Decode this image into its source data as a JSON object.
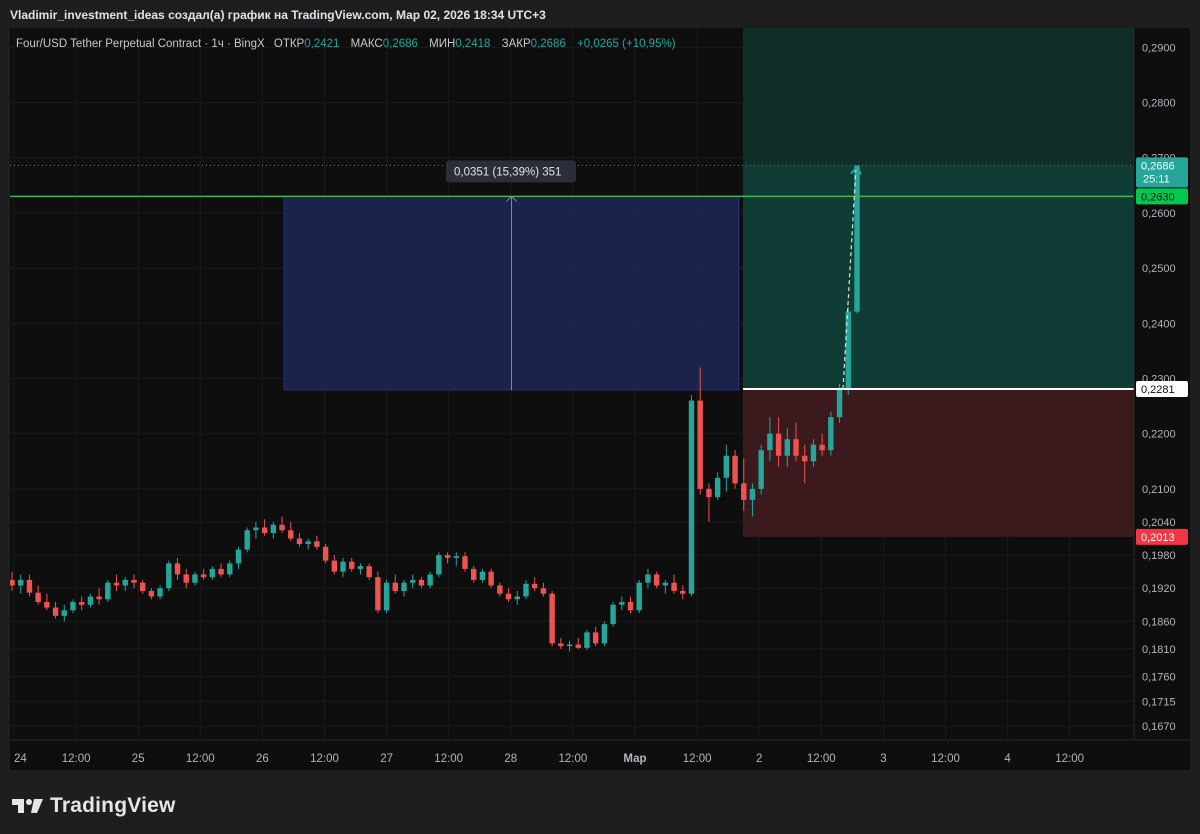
{
  "header": {
    "title": "Vladimir_investment_ideas создал(а) график на TradingView.com, Мар 02, 2026 18:34 UTC+3"
  },
  "legend": {
    "symbol": "Four/USD Tether Perpetual Contract · 1ч · BingX",
    "open_label": "ОТКР",
    "open": "0,2421",
    "high_label": "МАКС",
    "high": "0,2686",
    "low_label": "МИН",
    "low": "0,2418",
    "close_label": "ЗАКР",
    "close": "0,2686",
    "change": "+0,0265 (+10,95%)"
  },
  "measure_label": "0,0351 (15,39%) 351",
  "price_tags": {
    "last_price": "0,2686",
    "countdown": "25:11",
    "target": "0,2630",
    "entry": "0,2281",
    "stop": "0,2013"
  },
  "colors": {
    "up": "#26a69a",
    "down": "#ef5350",
    "background": "#0e0e0e",
    "green_line": "#4caf50",
    "measure_fill": "#1a2550",
    "profit_fill": "#0f3d36",
    "loss_fill": "#3a1a1c",
    "entry_line": "#ffffff"
  },
  "footer": {
    "brand": "TradingView",
    "logo_icon": "tradingview-logo-icon"
  },
  "chart_data": {
    "type": "candlestick",
    "timeframe": "1h",
    "symbol": "FOUR/USDT Perp",
    "price_scale": [
      "0,2900",
      "0,2800",
      "0,2700",
      "0,2600",
      "0,2500",
      "0,2400",
      "0,2300",
      "0,2200",
      "0,2100",
      "0,2040",
      "0,1980",
      "0,1920",
      "0,1860",
      "0,1810",
      "0,1760",
      "0,1715",
      "0,1670"
    ],
    "time_labels": [
      "24",
      "12:00",
      "25",
      "12:00",
      "26",
      "12:00",
      "27",
      "12:00",
      "28",
      "12:00",
      "Мар",
      "12:00",
      "2",
      "12:00",
      "3",
      "12:00",
      "4",
      "12:00"
    ],
    "price_range": [
      0.1645,
      0.2935
    ],
    "target_line": 0.263,
    "entry": 0.2281,
    "stop": 0.2013,
    "take_profit_zone_top": 0.2935,
    "last_price": 0.2686,
    "measure": {
      "from": 0.2279,
      "to": 0.263,
      "delta": "0,0351",
      "percent": "15,39%",
      "bars": 351
    },
    "candles": [
      [
        0.1935,
        0.195,
        0.1915,
        0.1925
      ],
      [
        0.1925,
        0.1945,
        0.191,
        0.1935
      ],
      [
        0.1935,
        0.1945,
        0.1905,
        0.1912
      ],
      [
        0.1912,
        0.1925,
        0.189,
        0.1895
      ],
      [
        0.1895,
        0.191,
        0.188,
        0.1885
      ],
      [
        0.1885,
        0.1895,
        0.1865,
        0.187
      ],
      [
        0.187,
        0.189,
        0.186,
        0.188
      ],
      [
        0.188,
        0.19,
        0.1875,
        0.1895
      ],
      [
        0.1895,
        0.1905,
        0.188,
        0.189
      ],
      [
        0.189,
        0.191,
        0.1885,
        0.1905
      ],
      [
        0.1905,
        0.192,
        0.189,
        0.19
      ],
      [
        0.19,
        0.1935,
        0.1895,
        0.193
      ],
      [
        0.193,
        0.1945,
        0.1915,
        0.1925
      ],
      [
        0.1925,
        0.194,
        0.1915,
        0.1935
      ],
      [
        0.1935,
        0.1945,
        0.192,
        0.193
      ],
      [
        0.193,
        0.1935,
        0.191,
        0.1915
      ],
      [
        0.1915,
        0.192,
        0.19,
        0.1905
      ],
      [
        0.1905,
        0.1925,
        0.19,
        0.192
      ],
      [
        0.192,
        0.197,
        0.1915,
        0.1965
      ],
      [
        0.1965,
        0.1975,
        0.1935,
        0.1945
      ],
      [
        0.1945,
        0.1955,
        0.192,
        0.193
      ],
      [
        0.193,
        0.195,
        0.1925,
        0.1945
      ],
      [
        0.1945,
        0.1955,
        0.1935,
        0.194
      ],
      [
        0.194,
        0.196,
        0.1935,
        0.1955
      ],
      [
        0.1955,
        0.1965,
        0.194,
        0.1945
      ],
      [
        0.1945,
        0.197,
        0.194,
        0.1965
      ],
      [
        0.1965,
        0.1995,
        0.1955,
        0.199
      ],
      [
        0.199,
        0.203,
        0.1985,
        0.2025
      ],
      [
        0.2025,
        0.204,
        0.201,
        0.203
      ],
      [
        0.203,
        0.2045,
        0.2015,
        0.202
      ],
      [
        0.202,
        0.204,
        0.201,
        0.2035
      ],
      [
        0.2035,
        0.205,
        0.202,
        0.2025
      ],
      [
        0.2025,
        0.204,
        0.2005,
        0.201
      ],
      [
        0.201,
        0.202,
        0.1995,
        0.2
      ],
      [
        0.2,
        0.201,
        0.199,
        0.2005
      ],
      [
        0.2005,
        0.2015,
        0.199,
        0.1995
      ],
      [
        0.1995,
        0.2,
        0.1965,
        0.197
      ],
      [
        0.197,
        0.198,
        0.1945,
        0.195
      ],
      [
        0.195,
        0.1975,
        0.194,
        0.1968
      ],
      [
        0.1968,
        0.1975,
        0.195,
        0.1955
      ],
      [
        0.1955,
        0.1965,
        0.1945,
        0.196
      ],
      [
        0.196,
        0.1965,
        0.1935,
        0.194
      ],
      [
        0.194,
        0.195,
        0.1875,
        0.188
      ],
      [
        0.188,
        0.1935,
        0.1875,
        0.193
      ],
      [
        0.193,
        0.1945,
        0.191,
        0.1915
      ],
      [
        0.1915,
        0.1935,
        0.1905,
        0.193
      ],
      [
        0.193,
        0.1945,
        0.192,
        0.1935
      ],
      [
        0.1935,
        0.194,
        0.192,
        0.1925
      ],
      [
        0.1925,
        0.195,
        0.192,
        0.1945
      ],
      [
        0.1945,
        0.1985,
        0.194,
        0.198
      ],
      [
        0.198,
        0.1985,
        0.1965,
        0.1975
      ],
      [
        0.1975,
        0.1985,
        0.196,
        0.1978
      ],
      [
        0.1978,
        0.1985,
        0.195,
        0.1955
      ],
      [
        0.1955,
        0.196,
        0.193,
        0.1935
      ],
      [
        0.1935,
        0.1955,
        0.193,
        0.195
      ],
      [
        0.195,
        0.1955,
        0.192,
        0.1925
      ],
      [
        0.1925,
        0.193,
        0.1905,
        0.191
      ],
      [
        0.191,
        0.192,
        0.1895,
        0.19
      ],
      [
        0.19,
        0.1915,
        0.189,
        0.1905
      ],
      [
        0.1905,
        0.1935,
        0.19,
        0.1928
      ],
      [
        0.1928,
        0.194,
        0.1915,
        0.192
      ],
      [
        0.192,
        0.193,
        0.1905,
        0.191
      ],
      [
        0.191,
        0.1915,
        0.1815,
        0.182
      ],
      [
        0.182,
        0.183,
        0.181,
        0.1815
      ],
      [
        0.1815,
        0.1825,
        0.1805,
        0.1818
      ],
      [
        0.1818,
        0.183,
        0.181,
        0.1812
      ],
      [
        0.1812,
        0.1845,
        0.1808,
        0.184
      ],
      [
        0.184,
        0.185,
        0.1815,
        0.182
      ],
      [
        0.182,
        0.186,
        0.1815,
        0.1855
      ],
      [
        0.1855,
        0.1895,
        0.185,
        0.189
      ],
      [
        0.189,
        0.1905,
        0.188,
        0.1895
      ],
      [
        0.1895,
        0.1905,
        0.1875,
        0.188
      ],
      [
        0.188,
        0.1935,
        0.1875,
        0.193
      ],
      [
        0.193,
        0.1955,
        0.192,
        0.1945
      ],
      [
        0.1945,
        0.195,
        0.192,
        0.1925
      ],
      [
        0.1925,
        0.1935,
        0.191,
        0.193
      ],
      [
        0.193,
        0.1945,
        0.191,
        0.1915
      ],
      [
        0.1915,
        0.1925,
        0.19,
        0.191
      ],
      [
        0.191,
        0.227,
        0.1905,
        0.226
      ],
      [
        0.226,
        0.232,
        0.209,
        0.21
      ],
      [
        0.21,
        0.211,
        0.204,
        0.2085
      ],
      [
        0.2085,
        0.213,
        0.208,
        0.212
      ],
      [
        0.212,
        0.218,
        0.2095,
        0.216
      ],
      [
        0.216,
        0.217,
        0.21,
        0.211
      ],
      [
        0.211,
        0.2155,
        0.206,
        0.208
      ],
      [
        0.208,
        0.211,
        0.205,
        0.21
      ],
      [
        0.21,
        0.218,
        0.209,
        0.217
      ],
      [
        0.217,
        0.223,
        0.215,
        0.22
      ],
      [
        0.22,
        0.223,
        0.214,
        0.216
      ],
      [
        0.216,
        0.221,
        0.214,
        0.219
      ],
      [
        0.219,
        0.222,
        0.215,
        0.216
      ],
      [
        0.216,
        0.218,
        0.211,
        0.215
      ],
      [
        0.215,
        0.219,
        0.214,
        0.218
      ],
      [
        0.218,
        0.22,
        0.216,
        0.217
      ],
      [
        0.217,
        0.224,
        0.216,
        0.223
      ],
      [
        0.223,
        0.229,
        0.222,
        0.228
      ],
      [
        0.228,
        0.243,
        0.227,
        0.2421
      ],
      [
        0.2421,
        0.2686,
        0.2418,
        0.2686
      ]
    ]
  }
}
